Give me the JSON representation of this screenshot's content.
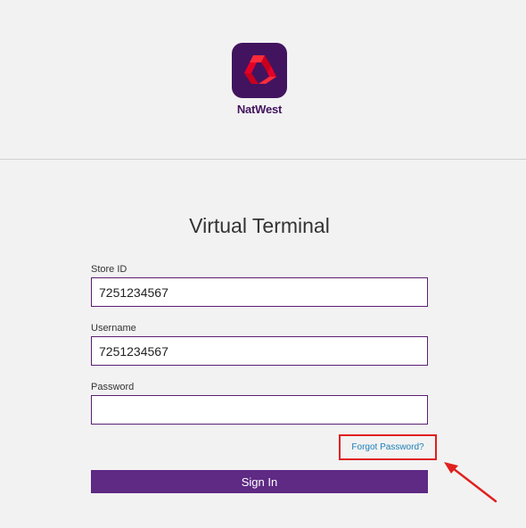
{
  "brand": {
    "name": "NatWest",
    "logo_icon": "natwest-cubes-logo",
    "color": "#42145f",
    "accent": "#e60028"
  },
  "page": {
    "title": "Virtual Terminal"
  },
  "form": {
    "store_id": {
      "label": "Store ID",
      "value": "7251234567"
    },
    "username": {
      "label": "Username",
      "value": "7251234567"
    },
    "password": {
      "label": "Password",
      "value": ""
    },
    "forgot_password_label": "Forgot Password?",
    "sign_in_label": "Sign In"
  },
  "annotation": {
    "highlight_color": "#e0201f",
    "arrow_icon": "red-arrow-pointer"
  }
}
